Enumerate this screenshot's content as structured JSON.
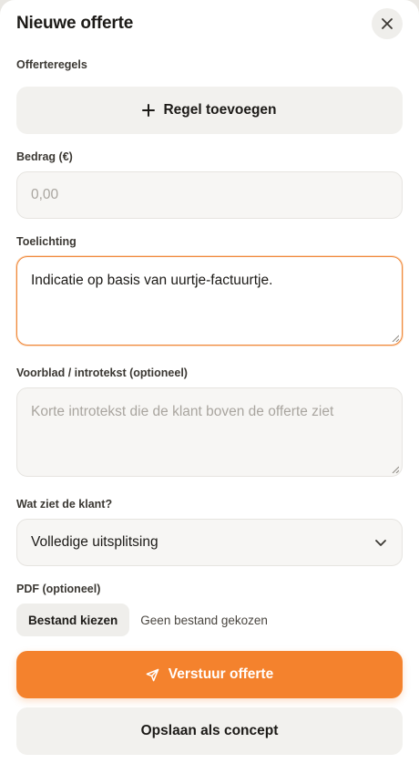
{
  "modal": {
    "title": "Nieuwe offerte"
  },
  "lines": {
    "label": "Offerteregels",
    "add_label": "Regel toevoegen"
  },
  "amount": {
    "label": "Bedrag (€)",
    "value": "",
    "placeholder": "0,00"
  },
  "note": {
    "label": "Toelichting",
    "value": "Indicatie op basis van uurtje-factuurtje."
  },
  "intro": {
    "label": "Voorblad / introtekst (optioneel)",
    "value": "",
    "placeholder": "Korte introtekst die de klant boven de offerte ziet"
  },
  "visibility": {
    "label": "Wat ziet de klant?",
    "selected": "Volledige uitsplitsing"
  },
  "pdf": {
    "label": "PDF (optioneel)",
    "button_label": "Bestand kiezen",
    "status": "Geen bestand gekozen"
  },
  "actions": {
    "send_label": "Verstuur offerte",
    "draft_label": "Opslaan als concept"
  },
  "colors": {
    "accent": "#f4822d",
    "focus_border": "#f0883a",
    "field_bg": "#f7f6f4"
  }
}
